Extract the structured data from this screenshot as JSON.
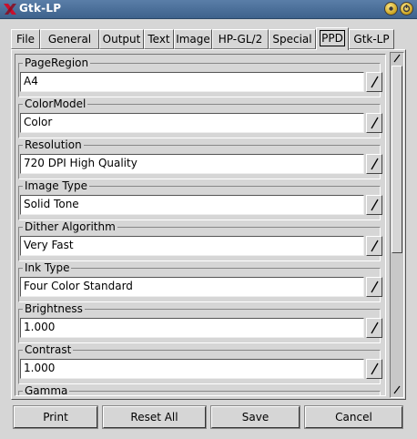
{
  "window": {
    "title": "Gtk-LP"
  },
  "tabs": [
    {
      "label": "File",
      "active": false
    },
    {
      "label": "General",
      "active": false
    },
    {
      "label": "Output",
      "active": false
    },
    {
      "label": "Text",
      "active": false
    },
    {
      "label": "Image",
      "active": false
    },
    {
      "label": "HP-GL/2",
      "active": false
    },
    {
      "label": "Special",
      "active": false
    },
    {
      "label": "PPD",
      "active": true
    },
    {
      "label": "Gtk-LP",
      "active": false
    }
  ],
  "options": [
    {
      "label": "PageRegion",
      "value": "A4"
    },
    {
      "label": "ColorModel",
      "value": "Color"
    },
    {
      "label": "Resolution",
      "value": "720 DPI High Quality"
    },
    {
      "label": "Image Type",
      "value": "Solid Tone"
    },
    {
      "label": "Dither Algorithm",
      "value": "Very Fast"
    },
    {
      "label": "Ink Type",
      "value": "Four Color Standard"
    },
    {
      "label": "Brightness",
      "value": "1.000"
    },
    {
      "label": "Contrast",
      "value": "1.000"
    },
    {
      "label": "Gamma",
      "value": ""
    }
  ],
  "buttons": {
    "print": "Print",
    "reset_all": "Reset All",
    "save": "Save",
    "cancel": "Cancel"
  },
  "icons": {
    "app": "gtk-lp-icon",
    "combo": "combo-arrow-icon",
    "scroll_up": "up-arrow-icon",
    "scroll_down": "down-arrow-icon"
  }
}
